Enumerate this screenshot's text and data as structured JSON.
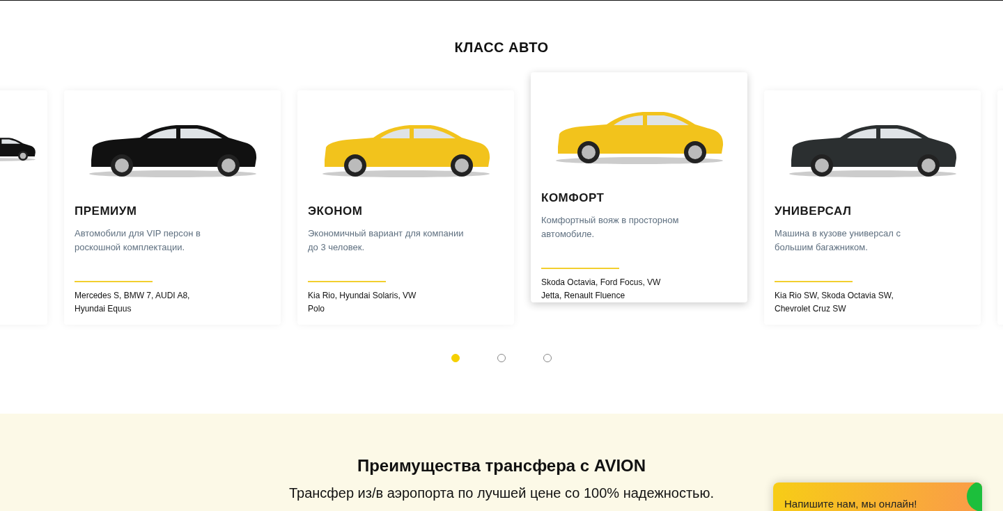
{
  "heading": "КЛАСС АВТО",
  "left_peek": {
    "color": "#111111"
  },
  "cards": [
    {
      "title": "ПРЕМИУМ",
      "description": "Автомобили для VIP персон в роскошной комплектации.",
      "models": "Mercedes S, BMW 7, AUDI A8, Hyundai Equus",
      "color": "#111111",
      "raised": false
    },
    {
      "title": "ЭКОНОМ",
      "description": "Экономичный вариант для компании до 3 человек.",
      "models": "Kia Rio, Hyundai Solaris, VW Polo",
      "color": "#f2c31c",
      "raised": false
    },
    {
      "title": "КОМФОРТ",
      "description": "Комфортный вояж в просторном автомобиле.",
      "models": "Skoda Octavia, Ford Focus, VW Jetta, Renault Fluence",
      "color": "#f2c31c",
      "raised": true
    },
    {
      "title": "УНИВЕРСАЛ",
      "description": "Машина в кузове универсал с большим багажником.",
      "models": "Kia Rio SW, Skoda Octavia SW, Chevrolet Cruz SW",
      "color": "#2b2f30",
      "raised": false
    }
  ],
  "dots": [
    {
      "selected": true
    },
    {
      "selected": false
    },
    {
      "selected": false
    }
  ],
  "advantages": {
    "title": "Преимущества трансфера с AVION",
    "subtitle": "Трансфер из/в аэропорта по лучшей цене со 100% надежностью."
  },
  "chat_widget": {
    "label": "Напишите нам, мы онлайн!"
  }
}
